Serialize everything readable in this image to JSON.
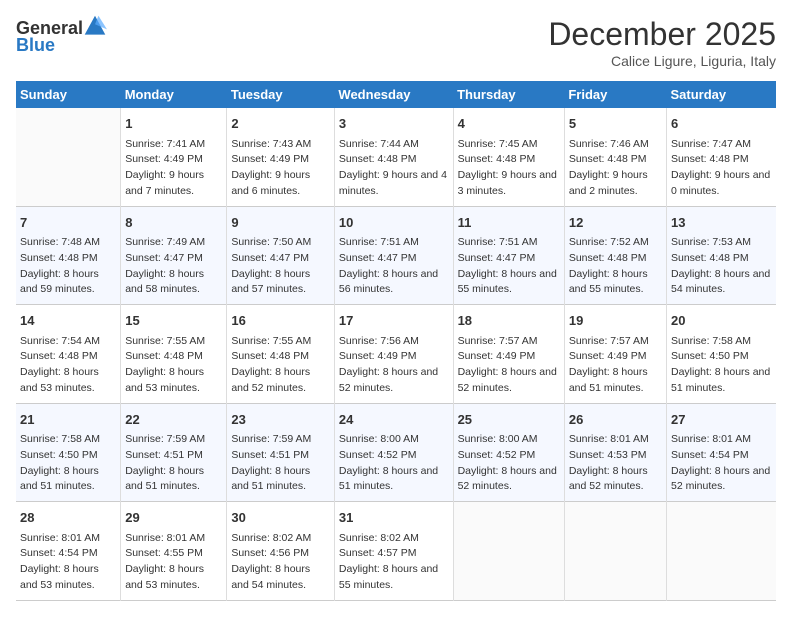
{
  "header": {
    "logo_general": "General",
    "logo_blue": "Blue",
    "month_title": "December 2025",
    "subtitle": "Calice Ligure, Liguria, Italy"
  },
  "columns": [
    "Sunday",
    "Monday",
    "Tuesday",
    "Wednesday",
    "Thursday",
    "Friday",
    "Saturday"
  ],
  "rows": [
    [
      {
        "day": "",
        "sunrise": "",
        "sunset": "",
        "daylight": ""
      },
      {
        "day": "1",
        "sunrise": "Sunrise: 7:41 AM",
        "sunset": "Sunset: 4:49 PM",
        "daylight": "Daylight: 9 hours and 7 minutes."
      },
      {
        "day": "2",
        "sunrise": "Sunrise: 7:43 AM",
        "sunset": "Sunset: 4:49 PM",
        "daylight": "Daylight: 9 hours and 6 minutes."
      },
      {
        "day": "3",
        "sunrise": "Sunrise: 7:44 AM",
        "sunset": "Sunset: 4:48 PM",
        "daylight": "Daylight: 9 hours and 4 minutes."
      },
      {
        "day": "4",
        "sunrise": "Sunrise: 7:45 AM",
        "sunset": "Sunset: 4:48 PM",
        "daylight": "Daylight: 9 hours and 3 minutes."
      },
      {
        "day": "5",
        "sunrise": "Sunrise: 7:46 AM",
        "sunset": "Sunset: 4:48 PM",
        "daylight": "Daylight: 9 hours and 2 minutes."
      },
      {
        "day": "6",
        "sunrise": "Sunrise: 7:47 AM",
        "sunset": "Sunset: 4:48 PM",
        "daylight": "Daylight: 9 hours and 0 minutes."
      }
    ],
    [
      {
        "day": "7",
        "sunrise": "Sunrise: 7:48 AM",
        "sunset": "Sunset: 4:48 PM",
        "daylight": "Daylight: 8 hours and 59 minutes."
      },
      {
        "day": "8",
        "sunrise": "Sunrise: 7:49 AM",
        "sunset": "Sunset: 4:47 PM",
        "daylight": "Daylight: 8 hours and 58 minutes."
      },
      {
        "day": "9",
        "sunrise": "Sunrise: 7:50 AM",
        "sunset": "Sunset: 4:47 PM",
        "daylight": "Daylight: 8 hours and 57 minutes."
      },
      {
        "day": "10",
        "sunrise": "Sunrise: 7:51 AM",
        "sunset": "Sunset: 4:47 PM",
        "daylight": "Daylight: 8 hours and 56 minutes."
      },
      {
        "day": "11",
        "sunrise": "Sunrise: 7:51 AM",
        "sunset": "Sunset: 4:47 PM",
        "daylight": "Daylight: 8 hours and 55 minutes."
      },
      {
        "day": "12",
        "sunrise": "Sunrise: 7:52 AM",
        "sunset": "Sunset: 4:48 PM",
        "daylight": "Daylight: 8 hours and 55 minutes."
      },
      {
        "day": "13",
        "sunrise": "Sunrise: 7:53 AM",
        "sunset": "Sunset: 4:48 PM",
        "daylight": "Daylight: 8 hours and 54 minutes."
      }
    ],
    [
      {
        "day": "14",
        "sunrise": "Sunrise: 7:54 AM",
        "sunset": "Sunset: 4:48 PM",
        "daylight": "Daylight: 8 hours and 53 minutes."
      },
      {
        "day": "15",
        "sunrise": "Sunrise: 7:55 AM",
        "sunset": "Sunset: 4:48 PM",
        "daylight": "Daylight: 8 hours and 53 minutes."
      },
      {
        "day": "16",
        "sunrise": "Sunrise: 7:55 AM",
        "sunset": "Sunset: 4:48 PM",
        "daylight": "Daylight: 8 hours and 52 minutes."
      },
      {
        "day": "17",
        "sunrise": "Sunrise: 7:56 AM",
        "sunset": "Sunset: 4:49 PM",
        "daylight": "Daylight: 8 hours and 52 minutes."
      },
      {
        "day": "18",
        "sunrise": "Sunrise: 7:57 AM",
        "sunset": "Sunset: 4:49 PM",
        "daylight": "Daylight: 8 hours and 52 minutes."
      },
      {
        "day": "19",
        "sunrise": "Sunrise: 7:57 AM",
        "sunset": "Sunset: 4:49 PM",
        "daylight": "Daylight: 8 hours and 51 minutes."
      },
      {
        "day": "20",
        "sunrise": "Sunrise: 7:58 AM",
        "sunset": "Sunset: 4:50 PM",
        "daylight": "Daylight: 8 hours and 51 minutes."
      }
    ],
    [
      {
        "day": "21",
        "sunrise": "Sunrise: 7:58 AM",
        "sunset": "Sunset: 4:50 PM",
        "daylight": "Daylight: 8 hours and 51 minutes."
      },
      {
        "day": "22",
        "sunrise": "Sunrise: 7:59 AM",
        "sunset": "Sunset: 4:51 PM",
        "daylight": "Daylight: 8 hours and 51 minutes."
      },
      {
        "day": "23",
        "sunrise": "Sunrise: 7:59 AM",
        "sunset": "Sunset: 4:51 PM",
        "daylight": "Daylight: 8 hours and 51 minutes."
      },
      {
        "day": "24",
        "sunrise": "Sunrise: 8:00 AM",
        "sunset": "Sunset: 4:52 PM",
        "daylight": "Daylight: 8 hours and 51 minutes."
      },
      {
        "day": "25",
        "sunrise": "Sunrise: 8:00 AM",
        "sunset": "Sunset: 4:52 PM",
        "daylight": "Daylight: 8 hours and 52 minutes."
      },
      {
        "day": "26",
        "sunrise": "Sunrise: 8:01 AM",
        "sunset": "Sunset: 4:53 PM",
        "daylight": "Daylight: 8 hours and 52 minutes."
      },
      {
        "day": "27",
        "sunrise": "Sunrise: 8:01 AM",
        "sunset": "Sunset: 4:54 PM",
        "daylight": "Daylight: 8 hours and 52 minutes."
      }
    ],
    [
      {
        "day": "28",
        "sunrise": "Sunrise: 8:01 AM",
        "sunset": "Sunset: 4:54 PM",
        "daylight": "Daylight: 8 hours and 53 minutes."
      },
      {
        "day": "29",
        "sunrise": "Sunrise: 8:01 AM",
        "sunset": "Sunset: 4:55 PM",
        "daylight": "Daylight: 8 hours and 53 minutes."
      },
      {
        "day": "30",
        "sunrise": "Sunrise: 8:02 AM",
        "sunset": "Sunset: 4:56 PM",
        "daylight": "Daylight: 8 hours and 54 minutes."
      },
      {
        "day": "31",
        "sunrise": "Sunrise: 8:02 AM",
        "sunset": "Sunset: 4:57 PM",
        "daylight": "Daylight: 8 hours and 55 minutes."
      },
      {
        "day": "",
        "sunrise": "",
        "sunset": "",
        "daylight": ""
      },
      {
        "day": "",
        "sunrise": "",
        "sunset": "",
        "daylight": ""
      },
      {
        "day": "",
        "sunrise": "",
        "sunset": "",
        "daylight": ""
      }
    ]
  ]
}
